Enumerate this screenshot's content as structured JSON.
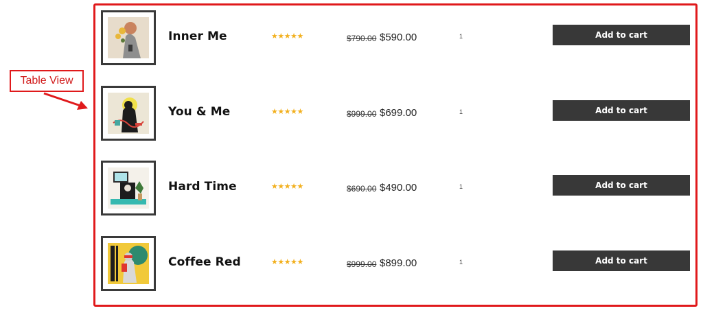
{
  "annotation": {
    "label": "Table View"
  },
  "products": [
    {
      "name": "Inner Me",
      "rating_stars": "★★★★★",
      "rating": 5,
      "old_price": "$790.00",
      "price": "$590.00",
      "qty": "1",
      "cart_label": "Add to cart"
    },
    {
      "name": "You & Me",
      "rating_stars": "★★★★★",
      "rating": 5,
      "old_price": "$999.00",
      "price": "$699.00",
      "qty": "1",
      "cart_label": "Add to cart"
    },
    {
      "name": "Hard Time",
      "rating_stars": "★★★★★",
      "rating": 5,
      "old_price": "$690.00",
      "price": "$490.00",
      "qty": "1",
      "cart_label": "Add to cart"
    },
    {
      "name": "Coffee Red",
      "rating_stars": "★★★★★",
      "rating": 5,
      "old_price": "$999.00",
      "price": "$899.00",
      "qty": "1",
      "cart_label": "Add to cart"
    }
  ],
  "colors": {
    "highlight_red": "#e0191b",
    "star": "#f2b01e",
    "button_bg": "#383838"
  }
}
